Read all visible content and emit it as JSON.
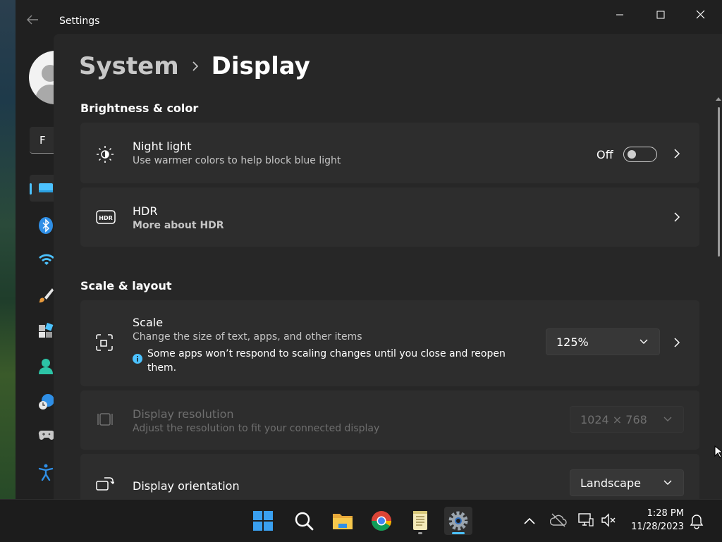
{
  "window": {
    "app_title": "Settings",
    "controls": {
      "minimize": "minimize",
      "maximize": "maximize",
      "close": "close"
    }
  },
  "sidebar": {
    "find_text": "F",
    "items": [
      {
        "name": "display-icon",
        "selected": true
      },
      {
        "name": "bluetooth-icon"
      },
      {
        "name": "wifi-icon"
      },
      {
        "name": "brush-icon"
      },
      {
        "name": "apps-icon"
      },
      {
        "name": "accounts-icon"
      },
      {
        "name": "time-language-icon"
      },
      {
        "name": "gamepad-icon"
      },
      {
        "name": "accessibility-icon"
      }
    ]
  },
  "breadcrumb": {
    "parent": "System",
    "current": "Display"
  },
  "brightness": {
    "section_title": "Brightness & color",
    "night_light": {
      "title": "Night light",
      "subtitle": "Use warmer colors to help block blue light",
      "state": "Off"
    },
    "hdr": {
      "title": "HDR",
      "link": "More about HDR"
    }
  },
  "scale_layout": {
    "section_title": "Scale & layout",
    "scale": {
      "title": "Scale",
      "subtitle": "Change the size of text, apps, and other items",
      "info": "Some apps won’t respond to scaling changes until you close and reopen them.",
      "value": "125%"
    },
    "resolution": {
      "title": "Display resolution",
      "subtitle": "Adjust the resolution to fit your connected display",
      "value": "1024 × 768"
    },
    "orientation": {
      "title": "Display orientation",
      "value": "Landscape"
    }
  },
  "taskbar": {
    "apps": [
      "windows-start-icon",
      "search-icon",
      "file-explorer-icon",
      "chrome-icon",
      "notepad-icon",
      "settings-icon"
    ],
    "clock": {
      "time": "1:28 PM",
      "date": "11/28/2023"
    }
  },
  "colors": {
    "accent": "#4cc2ff",
    "link": "#8fd3ff",
    "background": "#202020",
    "card": "#2d2d2d"
  }
}
